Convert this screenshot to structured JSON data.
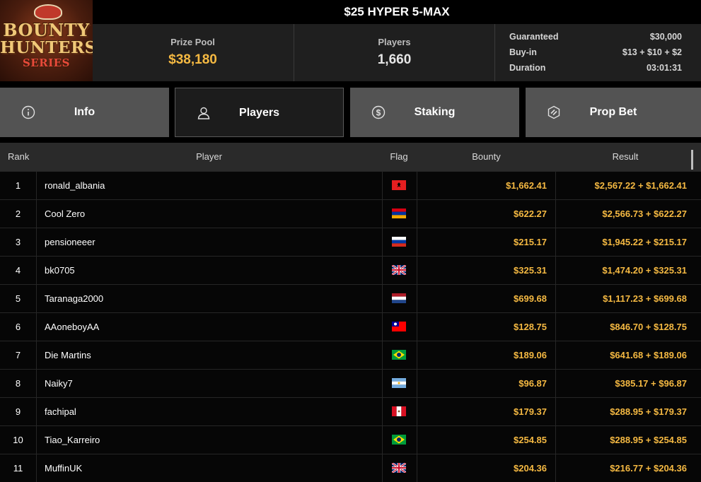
{
  "header": {
    "logo": {
      "line1": "BOUNTY",
      "line2": "HUNTERS",
      "line3": "SERIES"
    },
    "title": "$25 HYPER 5-MAX",
    "prize_pool": {
      "label": "Prize Pool",
      "value": "$38,180"
    },
    "players": {
      "label": "Players",
      "value": "1,660"
    },
    "details": [
      {
        "label": "Guaranteed",
        "value": "$30,000"
      },
      {
        "label": "Buy-in",
        "value": "$13 + $10 + $2"
      },
      {
        "label": "Duration",
        "value": "03:01:31"
      }
    ]
  },
  "tabs": [
    {
      "label": "Info",
      "icon": "info-icon",
      "active": false
    },
    {
      "label": "Players",
      "icon": "user-icon",
      "active": true
    },
    {
      "label": "Staking",
      "icon": "dollar-coin-icon",
      "active": false
    },
    {
      "label": "Prop Bet",
      "icon": "prop-bet-icon",
      "active": false
    }
  ],
  "table": {
    "columns": {
      "rank": "Rank",
      "player": "Player",
      "flag": "Flag",
      "bounty": "Bounty",
      "result": "Result"
    },
    "rows": [
      {
        "rank": "1",
        "player": "ronald_albania",
        "flag": "albania",
        "bounty": "$1,662.41",
        "result": "$2,567.22 + $1,662.41"
      },
      {
        "rank": "2",
        "player": "Cool Zero",
        "flag": "armenia",
        "bounty": "$622.27",
        "result": "$2,566.73 + $622.27"
      },
      {
        "rank": "3",
        "player": "pensioneeer",
        "flag": "russia",
        "bounty": "$215.17",
        "result": "$1,945.22 + $215.17"
      },
      {
        "rank": "4",
        "player": "bk0705",
        "flag": "united-kingdom",
        "bounty": "$325.31",
        "result": "$1,474.20 + $325.31"
      },
      {
        "rank": "5",
        "player": "Taranaga2000",
        "flag": "netherlands",
        "bounty": "$699.68",
        "result": "$1,117.23 + $699.68"
      },
      {
        "rank": "6",
        "player": "AAoneboyAA",
        "flag": "taiwan",
        "bounty": "$128.75",
        "result": "$846.70 + $128.75"
      },
      {
        "rank": "7",
        "player": "Die Martins",
        "flag": "brazil",
        "bounty": "$189.06",
        "result": "$641.68 + $189.06"
      },
      {
        "rank": "8",
        "player": "Naiky7",
        "flag": "argentina",
        "bounty": "$96.87",
        "result": "$385.17 + $96.87"
      },
      {
        "rank": "9",
        "player": "fachipal",
        "flag": "peru",
        "bounty": "$179.37",
        "result": "$288.95 + $179.37"
      },
      {
        "rank": "10",
        "player": "Tiao_Karreiro",
        "flag": "brazil",
        "bounty": "$254.85",
        "result": "$288.95 + $254.85"
      },
      {
        "rank": "11",
        "player": "MuffinUK",
        "flag": "united-kingdom",
        "bounty": "$204.36",
        "result": "$216.77 + $204.36"
      }
    ]
  },
  "colors": {
    "accent": "#f5b942",
    "tab_bg": "#535353",
    "tab_active_bg": "#1c1c1c",
    "header_bg": "#1f1f1f"
  }
}
